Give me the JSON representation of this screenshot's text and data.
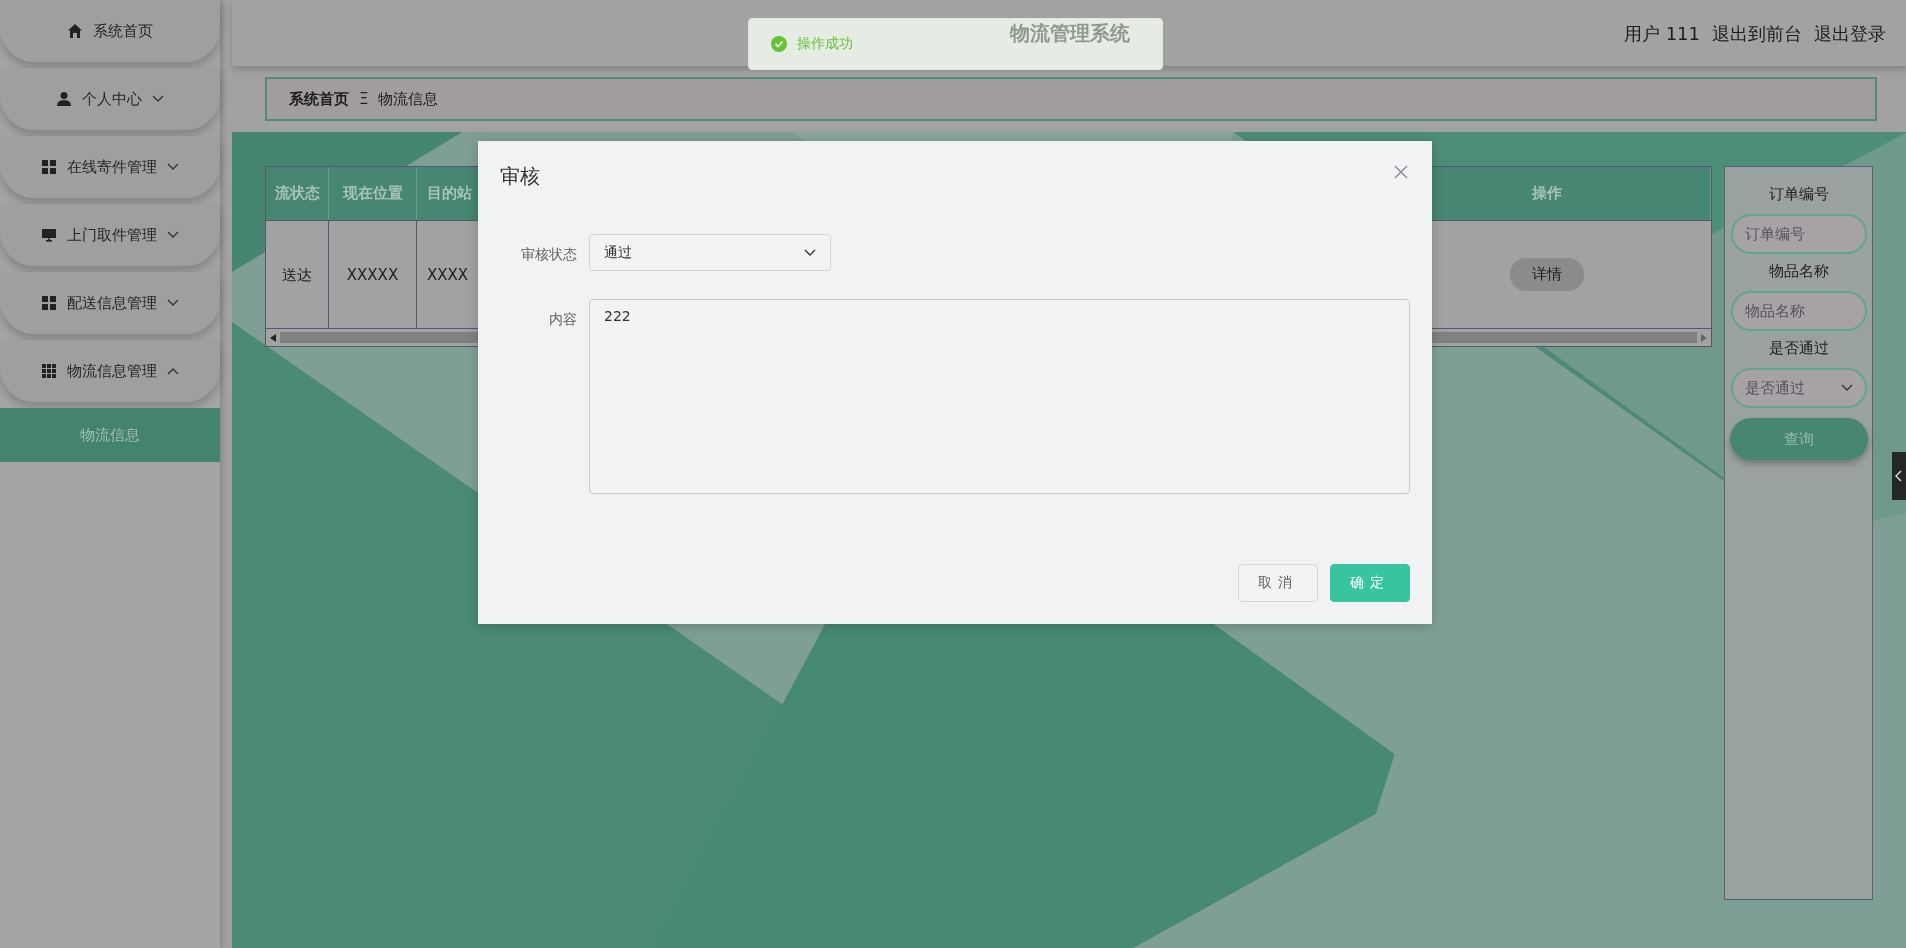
{
  "sidebar": {
    "items": [
      {
        "label": "系统首页",
        "kind": "link"
      },
      {
        "label": "个人中心",
        "kind": "menu",
        "expanded": false
      },
      {
        "label": "在线寄件管理",
        "kind": "menu",
        "expanded": false
      },
      {
        "label": "上门取件管理",
        "kind": "menu",
        "expanded": false
      },
      {
        "label": "配送信息管理",
        "kind": "menu",
        "expanded": false
      },
      {
        "label": "物流信息管理",
        "kind": "menu",
        "expanded": true,
        "children": [
          {
            "label": "物流信息",
            "selected": true
          }
        ]
      }
    ]
  },
  "header": {
    "title": "物流管理系统",
    "user": "用户 111",
    "links": [
      "退出到前台",
      "退出登录"
    ]
  },
  "toast": {
    "message": "操作成功"
  },
  "breadcrumb": {
    "items": [
      "系统首页",
      "物流信息"
    ],
    "separator": "Ξ"
  },
  "table": {
    "columns": [
      "流状态",
      "现在位置",
      "目的站",
      "操作"
    ],
    "rows": [
      {
        "cells": [
          {
            "kind": "text",
            "text": "送达"
          },
          {
            "kind": "text",
            "text": "XXXXX"
          },
          {
            "kind": "text",
            "text": "XXXX"
          },
          {
            "kind": "button",
            "text": "详情"
          }
        ]
      }
    ]
  },
  "search": {
    "fields": [
      {
        "label": "订单编号",
        "kind": "input",
        "placeholder": "订单编号"
      },
      {
        "label": "物品名称",
        "kind": "input",
        "placeholder": "物品名称"
      },
      {
        "label": "是否通过",
        "kind": "select",
        "placeholder": "是否通过"
      }
    ],
    "button": "查询"
  },
  "dialog": {
    "title": "审核",
    "fields": [
      {
        "label": "审核状态",
        "kind": "select",
        "value": "通过"
      },
      {
        "label": "内容",
        "kind": "textarea",
        "value": "222"
      }
    ],
    "buttons": [
      {
        "label": "取消",
        "kind": "default"
      },
      {
        "label": "确定",
        "kind": "primary"
      }
    ]
  }
}
